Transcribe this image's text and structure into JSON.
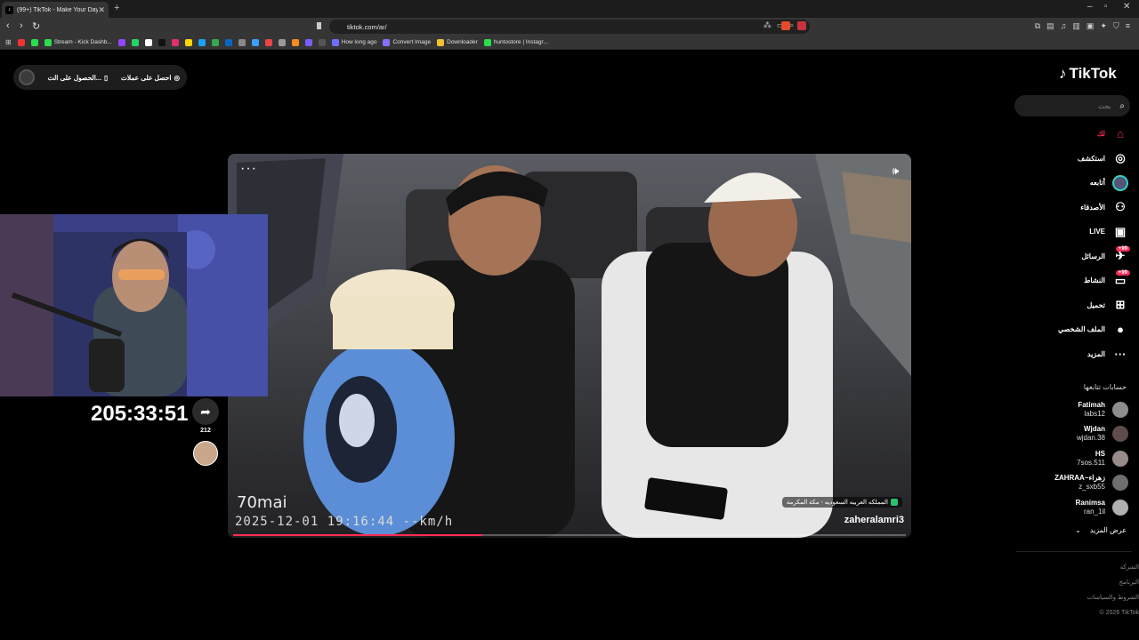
{
  "browser": {
    "tab_title": "(99+) TikTok - Make Your Day",
    "url": "tiktok.com/ar/",
    "bookmarks": [
      {
        "label": "",
        "color": "#e33"
      },
      {
        "label": "",
        "color": "#2bdc4b"
      },
      {
        "label": "Stream - Kick Dashb...",
        "color": "#2bdc4b"
      },
      {
        "label": "",
        "color": "#9146ff"
      },
      {
        "label": "",
        "color": "#25d366"
      },
      {
        "label": "",
        "color": "#ffffff"
      },
      {
        "label": "",
        "color": "#111111"
      },
      {
        "label": "",
        "color": "#e1306c"
      },
      {
        "label": "",
        "color": "#ffd600"
      },
      {
        "label": "",
        "color": "#1da1f2"
      },
      {
        "label": "",
        "color": "#34a853"
      },
      {
        "label": "",
        "color": "#0a66c2"
      },
      {
        "label": "",
        "color": "#888888"
      },
      {
        "label": "",
        "color": "#3aa0ff"
      },
      {
        "label": "",
        "color": "#e44"
      },
      {
        "label": "",
        "color": "#999999"
      },
      {
        "label": "",
        "color": "#f68b1f"
      },
      {
        "label": "",
        "color": "#7b5cff"
      },
      {
        "label": "",
        "color": "#555555"
      },
      {
        "label": "How long ago",
        "color": "#6f6fff"
      },
      {
        "label": "Convert Image",
        "color": "#8a6fff"
      },
      {
        "label": "Downloader",
        "color": "#f1c232"
      },
      {
        "label": "huntostore | Instagr...",
        "color": "#2bdc4b"
      }
    ]
  },
  "page": {
    "get_coins": "احصل على عملات",
    "get_app": "الحصول على الت..."
  },
  "video": {
    "cam_brand": "70mai",
    "cam_stamp": "2025-12-01 19:16:44  --km/h",
    "location": "المملكه العربيه السعوديه - مكة المكرمة",
    "username": "zaheralamri3",
    "progress": 0.37
  },
  "stream": {
    "timer": "205:33:51",
    "share_count": "212"
  },
  "sidebar": {
    "logo": "TikTok",
    "search_placeholder": "بحث",
    "nav": [
      {
        "label": "لك",
        "icon": "home-icon",
        "active": true
      },
      {
        "label": "استكشف",
        "icon": "compass-icon"
      },
      {
        "label": "أتابعه",
        "icon": "following-avatar-icon"
      },
      {
        "label": "الأصدقاء",
        "icon": "friends-icon"
      },
      {
        "label": "LIVE",
        "icon": "live-icon"
      },
      {
        "label": "الرسائل",
        "icon": "messages-icon",
        "badge": "+99"
      },
      {
        "label": "النشاط",
        "icon": "activity-icon",
        "badge": "+99"
      },
      {
        "label": "تحميل",
        "icon": "upload-icon"
      },
      {
        "label": "الملف الشخصي",
        "icon": "profile-icon"
      },
      {
        "label": "المزيد",
        "icon": "more-icon"
      }
    ],
    "following_header": "حسابات تتابعها",
    "following": [
      {
        "name": "Fatimah",
        "handle": "labs12"
      },
      {
        "name": "Wjdan",
        "handle": "wjdan.38"
      },
      {
        "name": "HS",
        "handle": "7sos.511"
      },
      {
        "name": "ZAHRAA~زهراء",
        "handle": "z_sxb55"
      },
      {
        "name": "Ranimsa",
        "handle": "ran_1il"
      }
    ],
    "see_more": "عرض المزيد",
    "footer": [
      "الشركة",
      "البرنامج",
      "الشروط والسياسات",
      "© 2026 TikTok"
    ]
  }
}
